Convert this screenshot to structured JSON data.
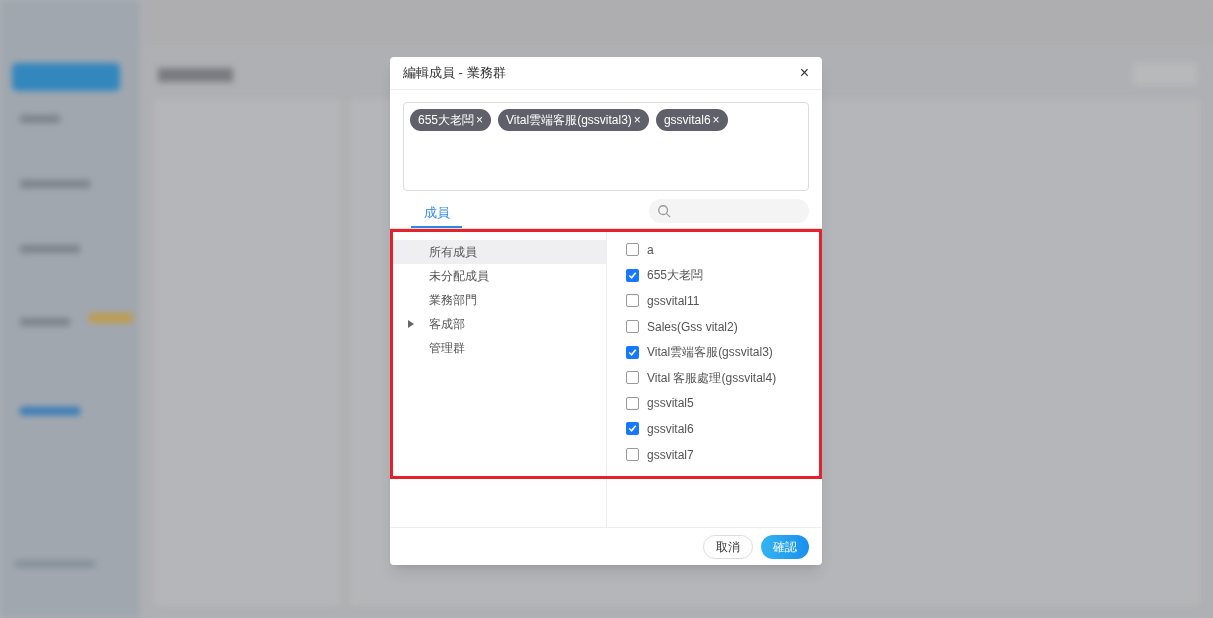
{
  "dialog": {
    "title": "編輯成員 - 業務群",
    "close": "×",
    "tags": [
      {
        "label": "655大老闆",
        "remove": "×"
      },
      {
        "label": "Vital雲端客服(gssvital3)",
        "remove": "×"
      },
      {
        "label": "gssvital6",
        "remove": "×"
      }
    ],
    "tabs": [
      {
        "label": "成員",
        "selected": true
      }
    ],
    "highlighted": true,
    "groups": [
      {
        "label": "所有成員",
        "selected": true
      },
      {
        "label": "未分配成員",
        "selected": false
      },
      {
        "label": "業務部門",
        "selected": false
      },
      {
        "label": "客成部",
        "selected": false,
        "expanded": false
      },
      {
        "label": "管理群",
        "selected": false
      }
    ],
    "members": [
      {
        "label": "a",
        "checked": false
      },
      {
        "label": "655大老闆",
        "checked": true
      },
      {
        "label": "gssvital11",
        "checked": false
      },
      {
        "label": "Sales(Gss vital2)",
        "checked": false
      },
      {
        "label": "Vital雲端客服(gssvital3)",
        "checked": true
      },
      {
        "label": "Vital 客服處理(gssvital4)",
        "checked": false
      },
      {
        "label": "gssvital5",
        "checked": false
      },
      {
        "label": "gssvital6",
        "checked": true
      },
      {
        "label": "gssvital7",
        "checked": false
      }
    ],
    "buttons": [
      {
        "label": "取消",
        "kind": "secondary"
      },
      {
        "label": "確認",
        "kind": "primary"
      }
    ]
  }
}
